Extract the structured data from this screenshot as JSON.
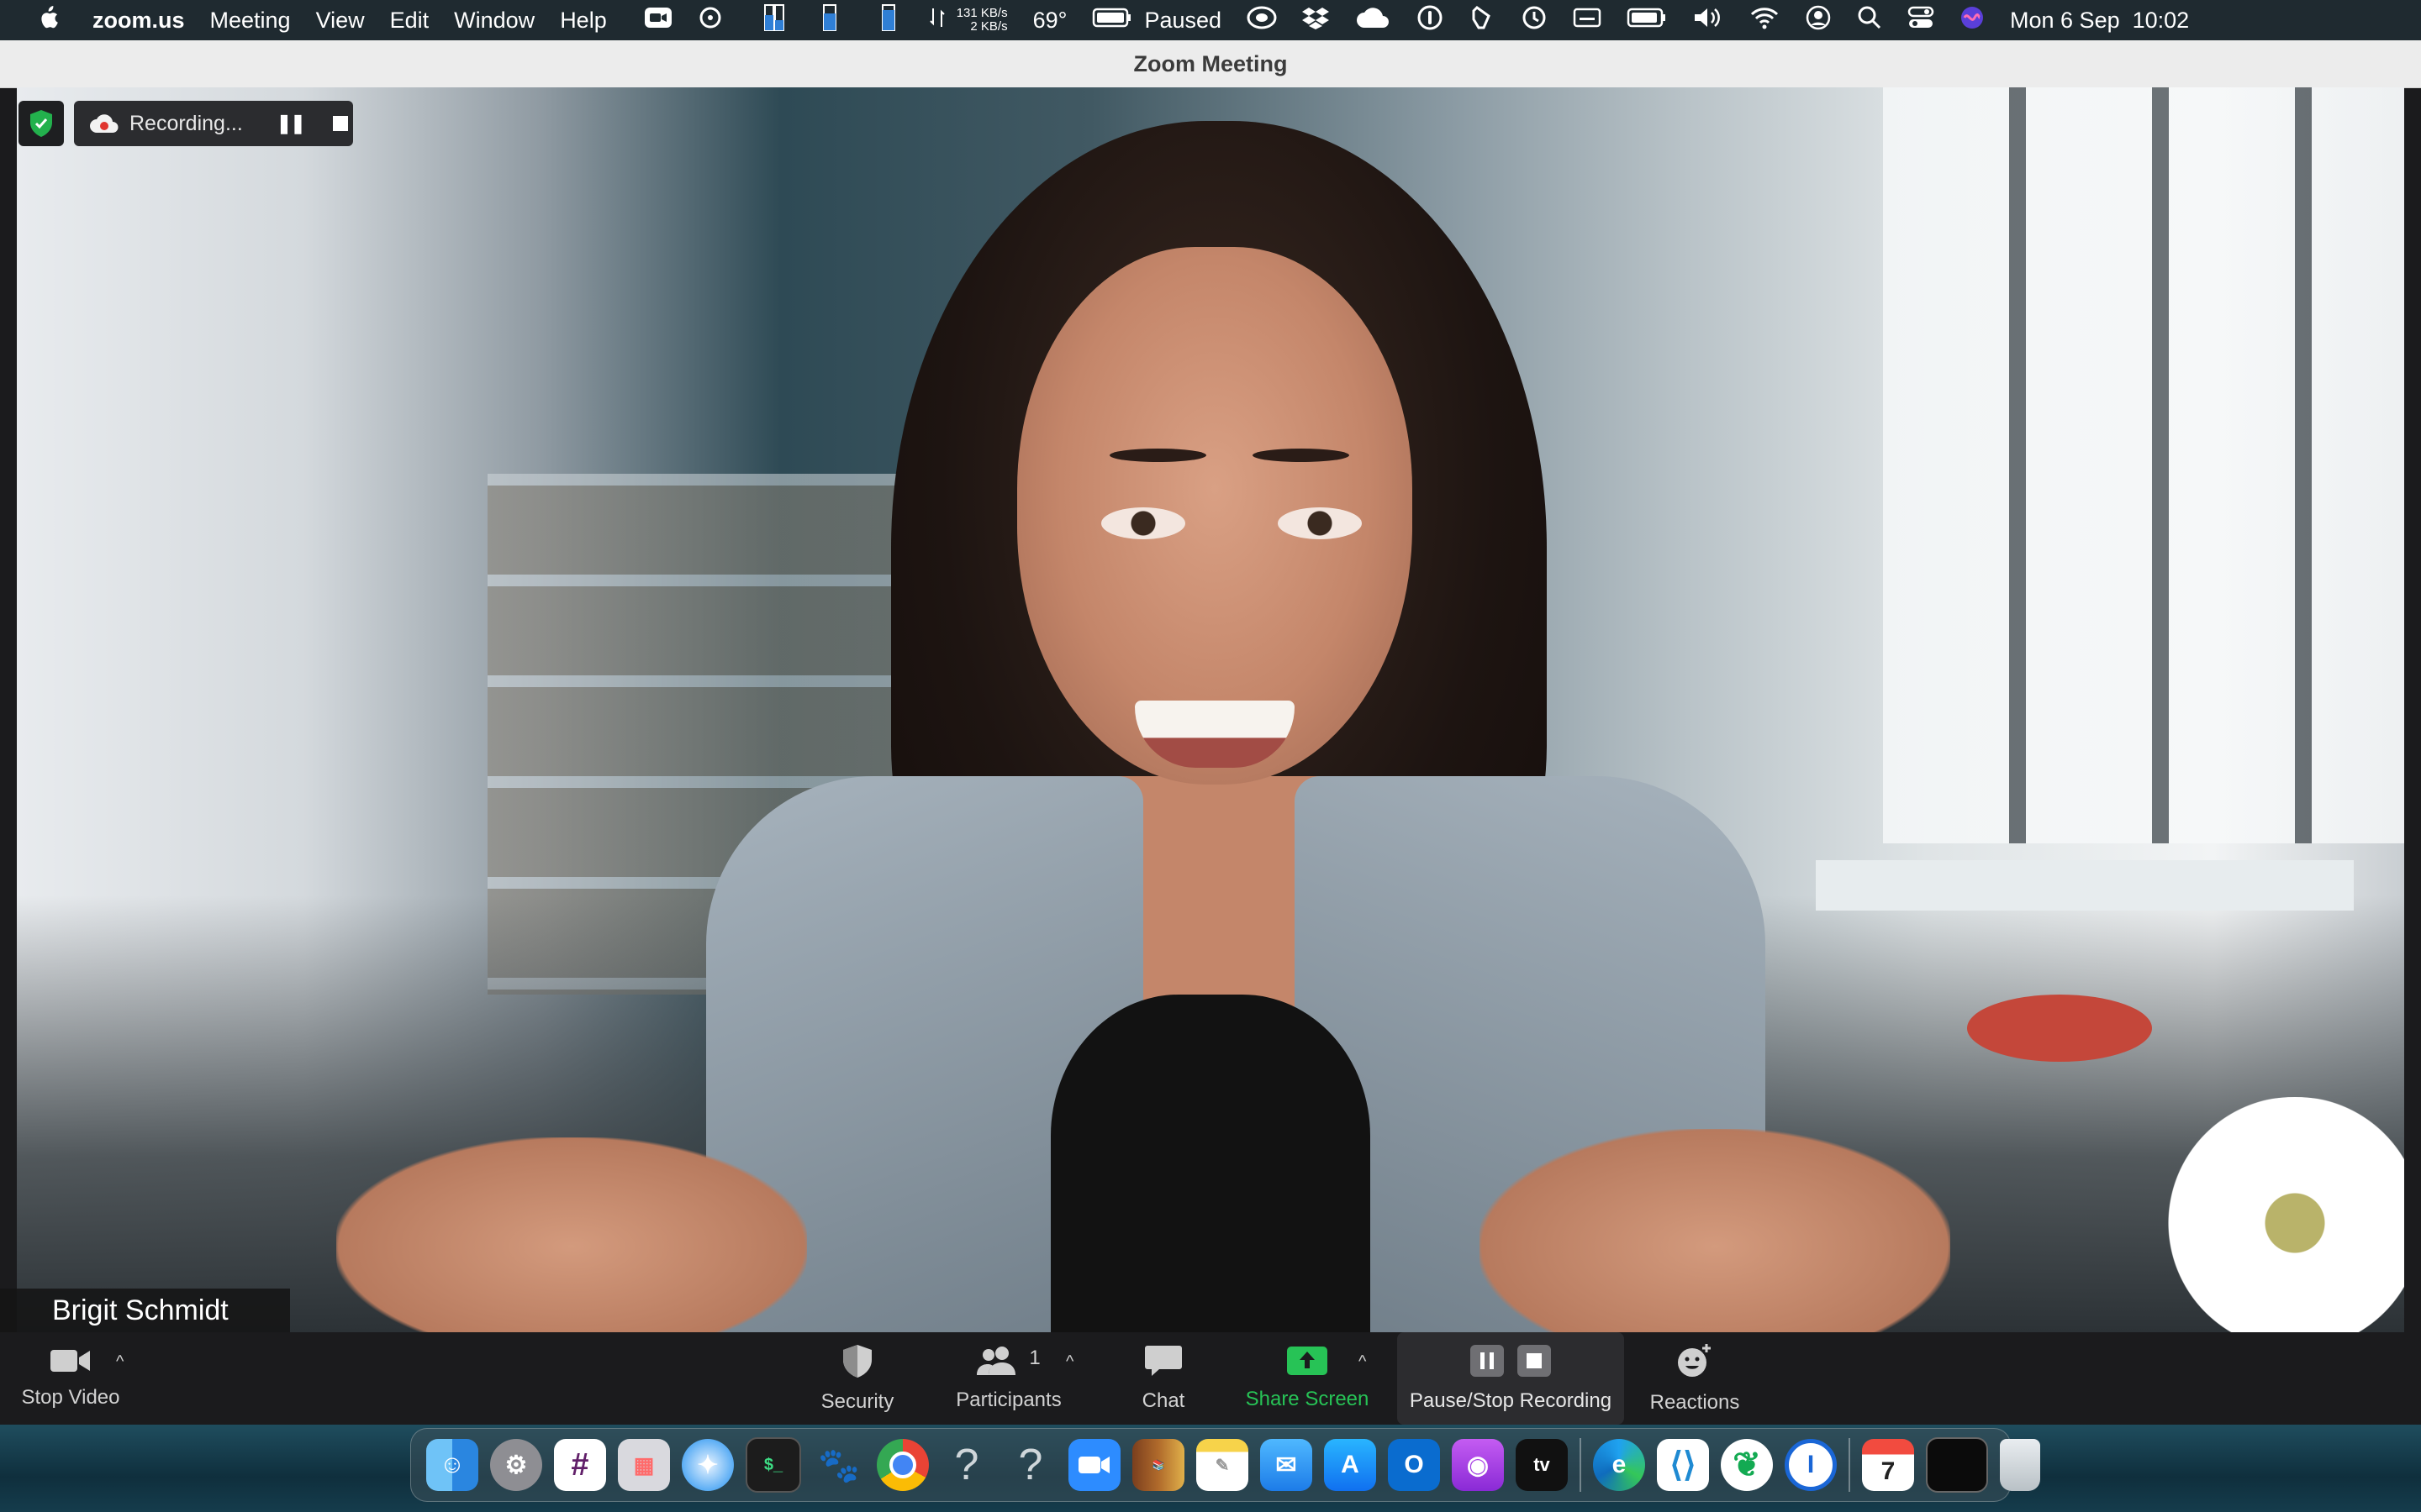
{
  "menubar": {
    "app_name": "zoom.us",
    "menus": [
      "Meeting",
      "View",
      "Edit",
      "Window",
      "Help"
    ],
    "net_up": "131 KB/s",
    "net_down": "2 KB/s",
    "temperature": "69°",
    "media_status": "Paused",
    "datetime": "Mon 6 Sep  10:02"
  },
  "window": {
    "title": "Zoom Meeting"
  },
  "recording": {
    "label": "Recording..."
  },
  "video": {
    "participant_name": "Brigit Schmidt"
  },
  "toolbar": {
    "stop_video": "Stop Video",
    "security": "Security",
    "participants": "Participants",
    "participants_count": "1",
    "chat": "Chat",
    "share_screen": "Share Screen",
    "pause_stop_recording": "Pause/Stop Recording",
    "reactions": "Reactions"
  },
  "colors": {
    "share_green": "#27c356",
    "security_green": "#23b14d",
    "toolbar_bg": "#1b1b1d",
    "title_bar": "#ececec"
  },
  "dock": {
    "icons": [
      "finder-icon",
      "system-preferences-icon",
      "slack-icon",
      "launchpad-icon",
      "safari-icon",
      "terminal-icon",
      "gimp-icon",
      "chrome-icon",
      "unknown-app-icon",
      "unknown-app-icon",
      "zoom-icon",
      "calibre-icon",
      "notes-icon",
      "mail-icon",
      "app-store-icon",
      "outlook-icon",
      "podcasts-icon",
      "apple-tv-icon",
      "edge-icon",
      "vscode-icon",
      "mongodb-compass-icon",
      "1password-icon",
      "calendar-icon",
      "screen-icon",
      "trash-icon"
    ],
    "calendar_day": "7"
  }
}
